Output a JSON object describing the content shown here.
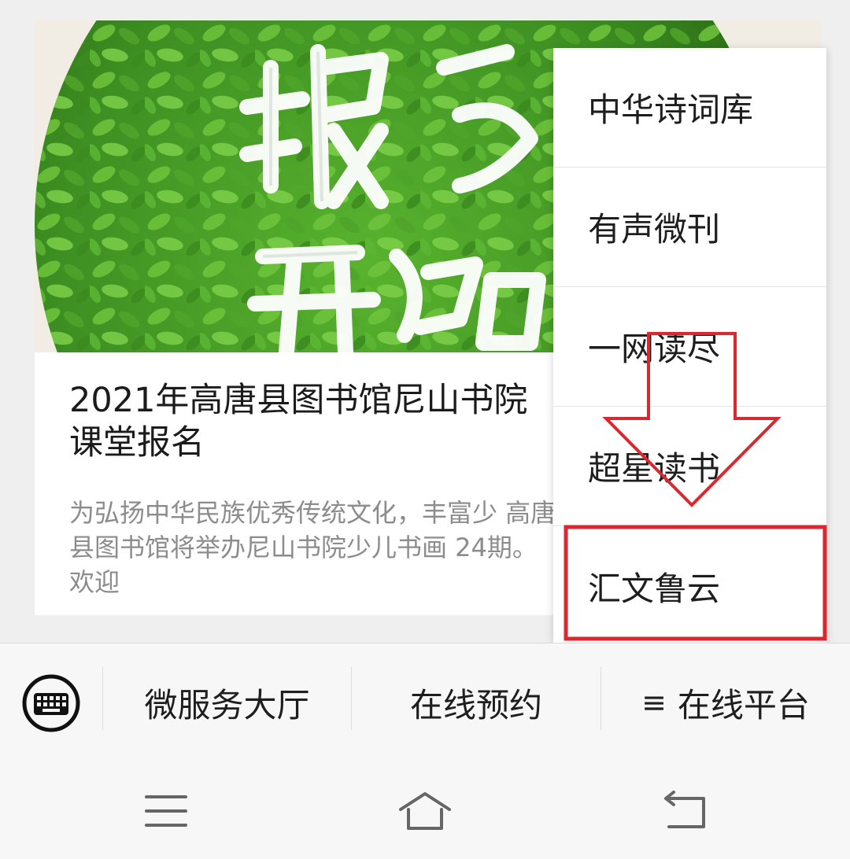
{
  "article": {
    "title": "2021年高唐县图书馆尼山书院课堂报名",
    "digest": "为弘扬中华民族优秀传统文化，丰富少 高唐县图书馆将举办尼山书院少儿书画 24期。欢迎",
    "cover_text": "报名开始"
  },
  "popup_menu": {
    "items": [
      {
        "label": "中华诗词库"
      },
      {
        "label": "有声微刊"
      },
      {
        "label": "一网读尽"
      },
      {
        "label": "超星读书"
      },
      {
        "label": "汇文鲁云"
      }
    ],
    "highlighted_item": "汇文鲁云"
  },
  "menubar": {
    "keyboard_icon": "keyboard-icon",
    "buttons": [
      {
        "label": "微服务大厅"
      },
      {
        "label": "在线预约"
      },
      {
        "label": "在线平台",
        "icon": "hamburger-icon",
        "glyph": "≡"
      }
    ]
  },
  "system_nav": {
    "icons": [
      "menu-icon",
      "home-icon",
      "back-icon"
    ]
  },
  "annotation_colors": {
    "arrow": "#d9282f",
    "highlight_box": "#d9282f"
  }
}
